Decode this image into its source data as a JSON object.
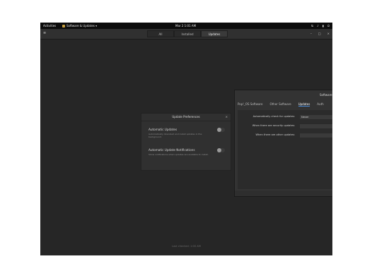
{
  "topbar": {
    "activities": "Activities",
    "app_menu": "Software & Updates ▾",
    "clock": "Mar 2  1:01 AM",
    "tray_icons": [
      "network-icon",
      "volume-icon",
      "battery-icon",
      "power-icon"
    ]
  },
  "header": {
    "tabs": [
      "All",
      "Installed",
      "Updates"
    ],
    "active_tab": "Updates"
  },
  "prefs_dialog": {
    "title": "Update Preferences",
    "rows": [
      {
        "label": "Automatic Updates",
        "desc": "Automatically download and install updates in the background."
      },
      {
        "label": "Automatic Update Notifications",
        "desc": "Show notifications when updates are available to install."
      }
    ]
  },
  "software_window": {
    "title": "Software",
    "tabs": [
      "Pop!_OS Software",
      "Other Software",
      "Updates",
      "Auth"
    ],
    "active_tab": "Updates",
    "form": [
      {
        "label": "Automatically check for updates:",
        "value": "Never"
      },
      {
        "label": "When there are security updates:",
        "value": ""
      },
      {
        "label": "When there are other updates:",
        "value": ""
      }
    ]
  },
  "status": "Last checked: 1:00 AM"
}
